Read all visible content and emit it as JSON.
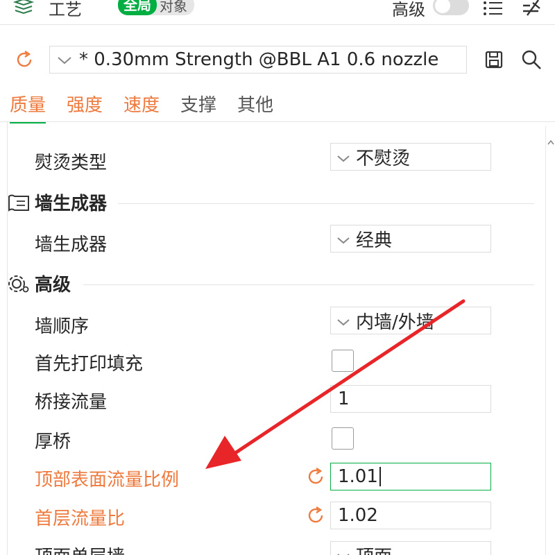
{
  "header": {
    "title": "工艺",
    "scope_on": "全局",
    "scope_off": "对象",
    "advanced_label": "高级",
    "advanced_enabled": false
  },
  "preset": {
    "name": "* 0.30mm Strength @BBL A1 0.6 nozzle"
  },
  "tabs": [
    {
      "label": "质量",
      "active": true
    },
    {
      "label": "强度",
      "changed": true
    },
    {
      "label": "速度",
      "changed": true
    },
    {
      "label": "支撑"
    },
    {
      "label": "其他"
    }
  ],
  "rows": {
    "ironing_type": {
      "label": "熨烫类型",
      "value": "不熨烫"
    },
    "wall_generator_section": "墙生成器",
    "wall_generator": {
      "label": "墙生成器",
      "value": "经典"
    },
    "advanced_section": "高级",
    "wall_order": {
      "label": "墙顺序",
      "value": "内墙/外墙"
    },
    "infill_first": {
      "label": "首先打印填充",
      "checked": false
    },
    "bridge_flow": {
      "label": "桥接流量",
      "value": "1"
    },
    "thick_bridges": {
      "label": "厚桥",
      "checked": false
    },
    "top_surface_flow": {
      "label": "顶部表面流量比例",
      "value": "1.01",
      "modified": true
    },
    "first_layer_flow": {
      "label": "首层流量比",
      "value": "1.02",
      "modified": true
    },
    "top_one_wall": {
      "label": "顶面单层墙",
      "value": "顶面"
    }
  },
  "colors": {
    "accent_green": "#00ae42",
    "modified_orange": "#ee7a3e",
    "arrow_red": "#e8262a"
  }
}
